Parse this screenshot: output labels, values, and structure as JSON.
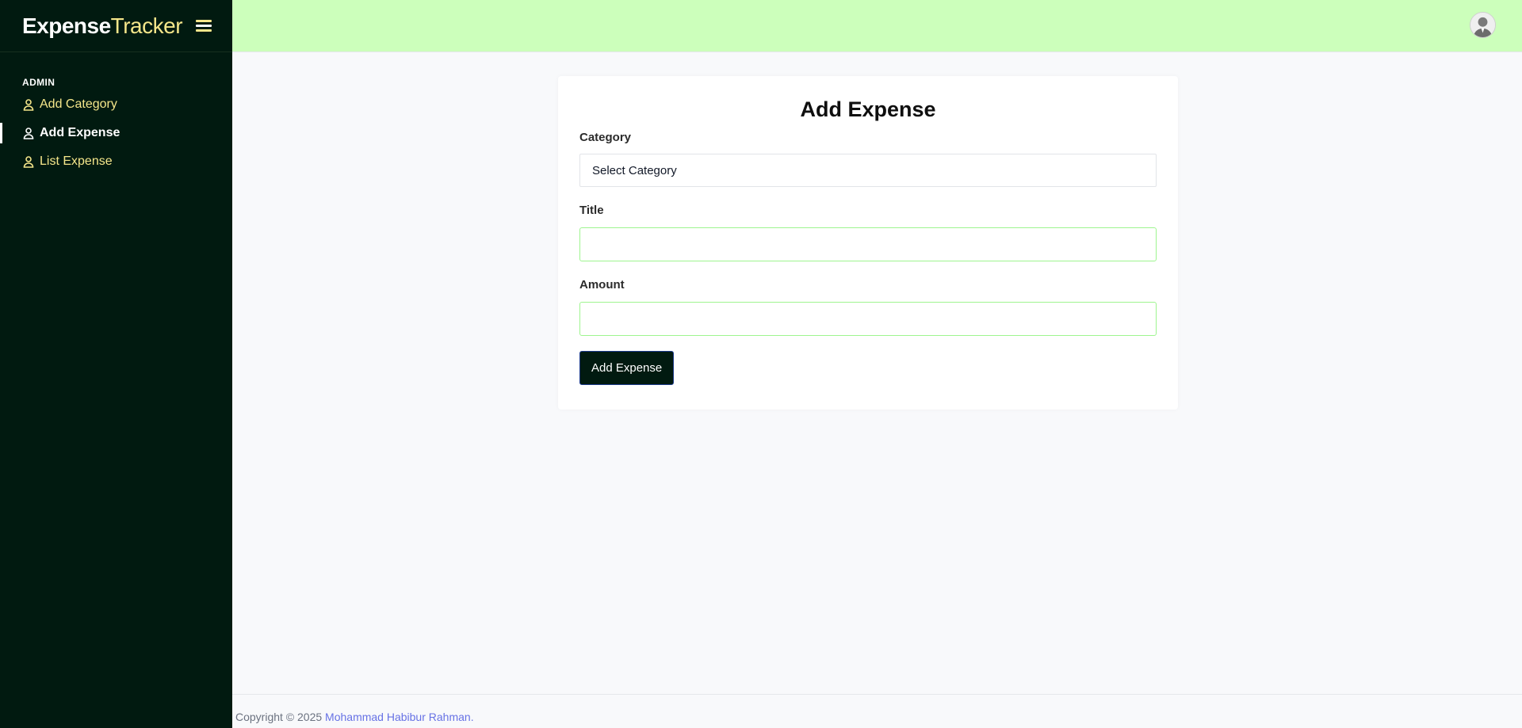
{
  "brand": {
    "strong": "Expense",
    "light": "Tracker"
  },
  "sidebar": {
    "section_label": "ADMIN",
    "items": [
      {
        "label": "Add Category",
        "icon": "user-icon",
        "active": false
      },
      {
        "label": "Add Expense",
        "icon": "user-icon",
        "active": true
      },
      {
        "label": "List Expense",
        "icon": "user-icon",
        "active": false
      }
    ]
  },
  "header": {
    "avatar_icon": "user-avatar-icon"
  },
  "form": {
    "title": "Add Expense",
    "category_label": "Category",
    "category_selected": "Select Category",
    "title_label": "Title",
    "title_value": "",
    "amount_label": "Amount",
    "amount_value": "",
    "submit_label": "Add Expense"
  },
  "footer": {
    "prefix": "Copyright © 2025",
    "author": "Mohammad Habibur Rahman",
    "suffix": "."
  },
  "colors": {
    "sidebar_bg": "#011a10",
    "header_bg": "#ccffbb",
    "accent_text": "#f5e68a",
    "input_border": "#9ef58f",
    "link": "#6772e5"
  }
}
